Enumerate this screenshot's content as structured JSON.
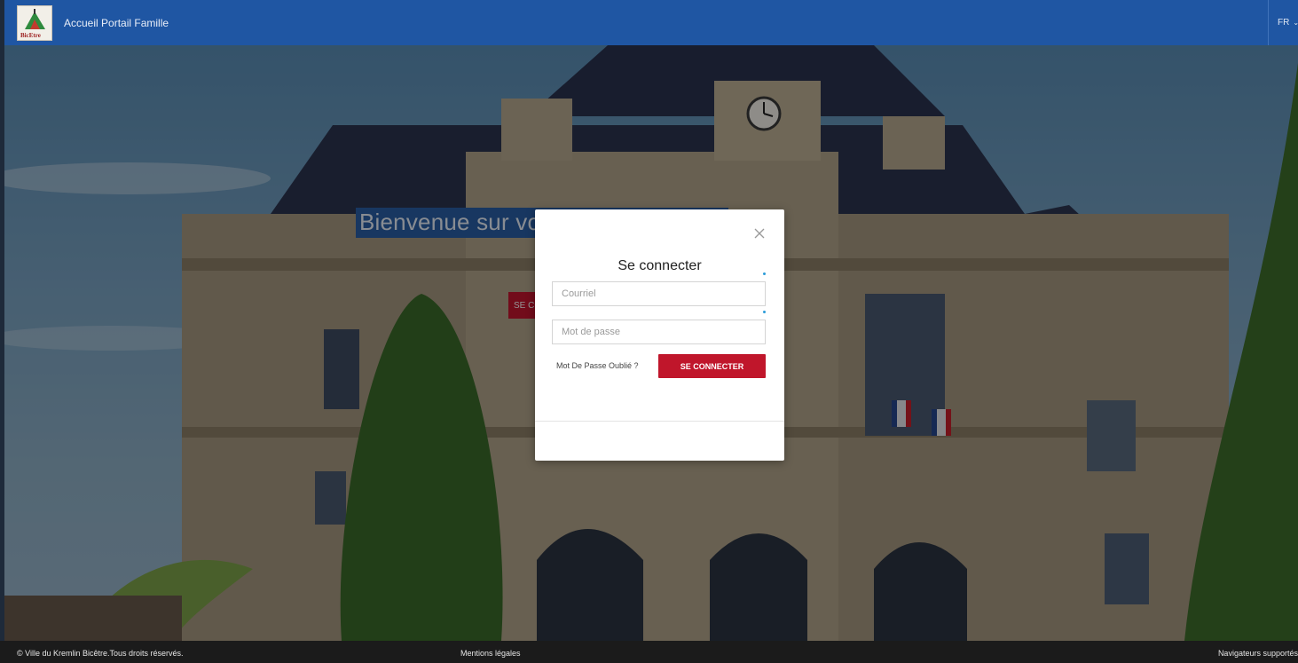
{
  "header": {
    "logo_text": "BicEtre",
    "title": "Accueil Portail Famille",
    "language": "FR"
  },
  "welcome": {
    "heading": "Bienvenue sur votre Portail Famille",
    "button_label": "SE CONNECTER"
  },
  "login_modal": {
    "title": "Se connecter",
    "email_placeholder": "Courriel",
    "password_placeholder": "Mot de passe",
    "forgot_password": "Mot De Passe Oublié ?",
    "submit_label": "SE CONNECTER"
  },
  "footer": {
    "copyright": "© Ville du Kremlin Bicêtre.Tous droits réservés.",
    "legal": "Mentions légales",
    "browsers": "Navigateurs supportés"
  },
  "colors": {
    "header_blue": "#1f56a3",
    "accent_red": "#c0162b",
    "footer": "#1b1b1b"
  }
}
